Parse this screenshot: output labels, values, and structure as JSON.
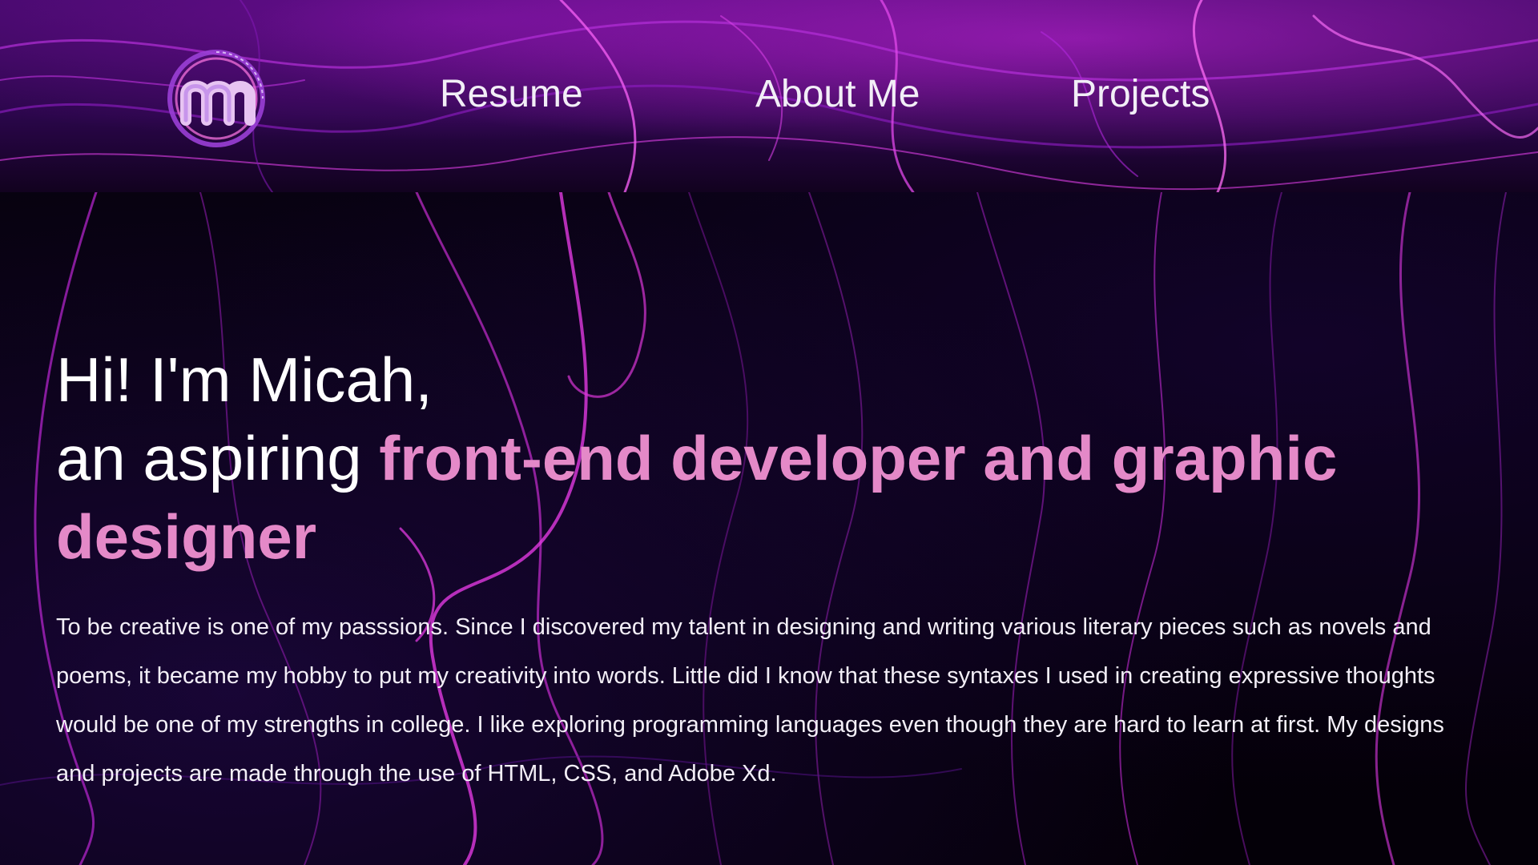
{
  "header": {
    "logo_icon": "m-logo-icon",
    "nav": [
      {
        "label": "Resume"
      },
      {
        "label": "About Me"
      },
      {
        "label": "Projects"
      }
    ]
  },
  "hero": {
    "greeting": "Hi! I'm Micah,",
    "intro_prefix": "an aspiring ",
    "role": "front-end developer and graphic designer",
    "body": "To be creative is one of my passsions. Since I discovered my talent in designing and writing various literary pieces such as novels and poems, it became my hobby to put my creativity into words. Little did I know that these syntaxes I used in creating expressive thoughts would be one of my strengths in college. I like exploring programming languages even though they are hard to learn at first. My designs and projects are made through the use of HTML, CSS, and Adobe Xd."
  },
  "colors": {
    "accent": "#e489c8",
    "header_purple": "#3a0860",
    "background": "#05010d",
    "text": "#ffffff"
  }
}
